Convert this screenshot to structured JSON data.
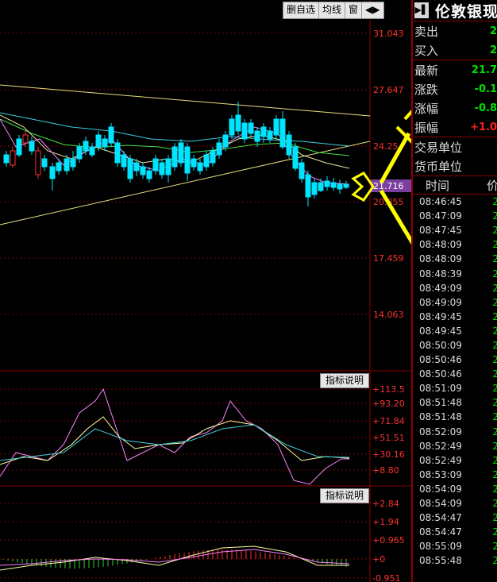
{
  "toolbar": {
    "items": [
      "删自选",
      "均线",
      "窗",
      "◀▶"
    ]
  },
  "price_axis": [
    "31.043",
    "27.647",
    "24.25",
    "21.716",
    "20.855",
    "17.459",
    "14.063"
  ],
  "indicator1": {
    "label": "指标说明",
    "axis": [
      "+113.5",
      "+93.20",
      "+71.84",
      "+51.51",
      "+30.16",
      "+8.80"
    ]
  },
  "indicator2": {
    "label": "指标说明",
    "axis": [
      "+2.84",
      "+1.94",
      "+0.965",
      "+0",
      "-0.951"
    ]
  },
  "panel": {
    "icon": "▶▌",
    "title": "伦敦银现",
    "rows": [
      {
        "label": "卖出",
        "value": "2"
      },
      {
        "label": "买入",
        "value": "2"
      },
      {
        "label": "最新",
        "value": "21.7"
      },
      {
        "label": "涨跌",
        "value": "-0.1"
      },
      {
        "label": "涨幅",
        "value": "-0.8"
      },
      {
        "label": "振幅",
        "value": "+1.0"
      },
      {
        "label": "交易单位",
        "value": ""
      },
      {
        "label": "货币单位",
        "value": ""
      }
    ],
    "list_header": {
      "time": "时间",
      "price": "价"
    },
    "ticks": [
      {
        "time": "08:46:45",
        "price": "2"
      },
      {
        "time": "08:47:09",
        "price": "2"
      },
      {
        "time": "08:47:45",
        "price": "2"
      },
      {
        "time": "08:48:09",
        "price": "2"
      },
      {
        "time": "08:48:09",
        "price": "2"
      },
      {
        "time": "08:48:39",
        "price": "2"
      },
      {
        "time": "08:49:09",
        "price": "2"
      },
      {
        "time": "08:49:09",
        "price": "2"
      },
      {
        "time": "08:49:45",
        "price": "2"
      },
      {
        "time": "08:49:45",
        "price": "2"
      },
      {
        "time": "08:50:09",
        "price": "2"
      },
      {
        "time": "08:50:46",
        "price": "2"
      },
      {
        "time": "08:50:46",
        "price": "2"
      },
      {
        "time": "08:51:09",
        "price": "2"
      },
      {
        "time": "08:51:48",
        "price": "2"
      },
      {
        "time": "08:51:48",
        "price": "2"
      },
      {
        "time": "08:52:09",
        "price": "2"
      },
      {
        "time": "08:52:49",
        "price": "2"
      },
      {
        "time": "08:52:49",
        "price": "2"
      },
      {
        "time": "08:53:09",
        "price": "2"
      },
      {
        "time": "08:54:09",
        "price": "2"
      },
      {
        "time": "08:54:09",
        "price": "2"
      },
      {
        "time": "08:54:47",
        "price": "2"
      },
      {
        "time": "08:54:47",
        "price": "2"
      },
      {
        "time": "08:55:09",
        "price": "2"
      },
      {
        "time": "08:55:48",
        "price": "2"
      }
    ]
  },
  "colors": {
    "up": "#ff3030",
    "down": "#00e5ff",
    "axis": "#8b0000",
    "panel_green": "#00e000",
    "panel_red": "#ff2020"
  }
}
